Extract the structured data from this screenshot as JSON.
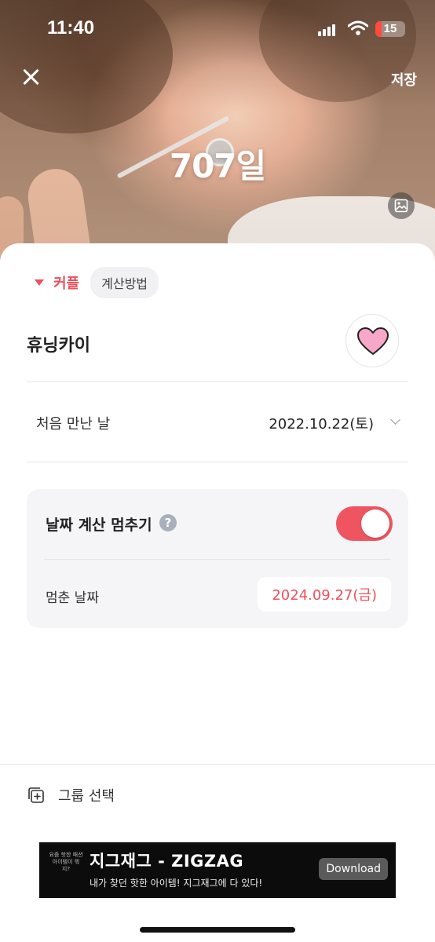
{
  "status_bar": {
    "time": "11:40",
    "battery": "15"
  },
  "header": {
    "save_label": "저장",
    "day_count": "707일"
  },
  "type_selector": {
    "label": "커플",
    "calc_method_label": "계산방법"
  },
  "person": {
    "name": "휴닝카이"
  },
  "first_meet": {
    "label": "처음 만난 날",
    "value": "2022.10.22(토)"
  },
  "stop_calc": {
    "title": "날짜 계산 멈추기",
    "help_glyph": "?",
    "enabled": true,
    "stop_date_label": "멈춘 날짜",
    "stop_date_value": "2024.09.27(금)"
  },
  "group": {
    "label": "그룹 선택"
  },
  "ad": {
    "thumb_text": "요즘 핫한 패션 아이템이 뭐지?",
    "title": "지그재그 - ZIGZAG",
    "subtitle": "내가 찾던 핫한 아이템! 지그재그에 다 있다!",
    "button_label": "Download"
  },
  "colors": {
    "accent": "#ef4f5b",
    "toggle_on": "#ef5560",
    "heart": "#f7a8c8"
  }
}
